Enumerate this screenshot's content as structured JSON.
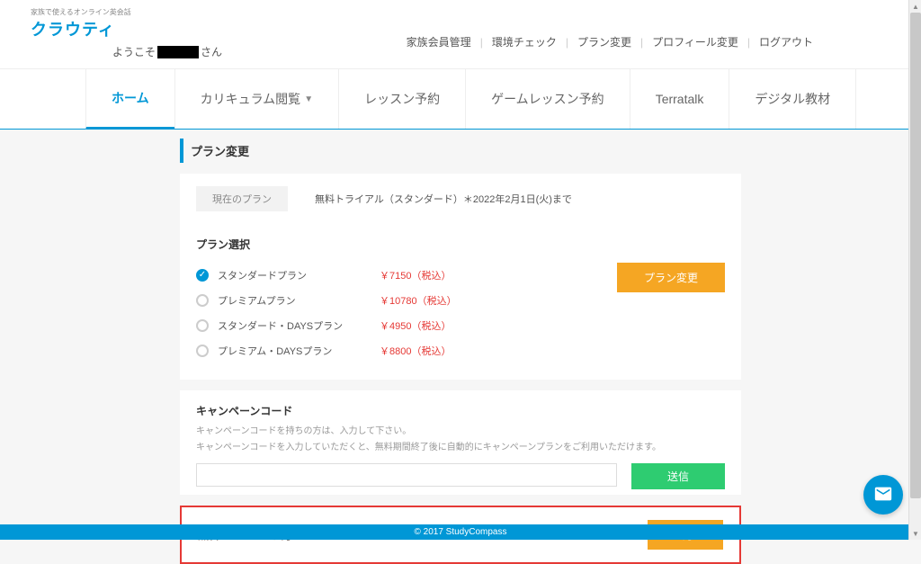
{
  "logo": {
    "tagline": "家族で使えるオンライン英会話",
    "brand": "クラウティ"
  },
  "greeting": {
    "prefix": "ようこそ",
    "suffix": "さん"
  },
  "toplinks": [
    "家族会員管理",
    "環境チェック",
    "プラン変更",
    "プロフィール変更",
    "ログアウト"
  ],
  "tabs": [
    {
      "label": "ホーム",
      "active": true
    },
    {
      "label": "カリキュラム閲覧",
      "dropdown": true
    },
    {
      "label": "レッスン予約"
    },
    {
      "label": "ゲームレッスン予約"
    },
    {
      "label": "Terratalk"
    },
    {
      "label": "デジタル教材"
    }
  ],
  "page_title": "プラン変更",
  "current_plan": {
    "badge": "現在のプラン",
    "text": "無料トライアル（スタンダード）＊2022年2月1日(火)まで"
  },
  "plan_select_heading": "プラン選択",
  "plans": [
    {
      "name": "スタンダードプラン",
      "price": "￥7150（税込）",
      "selected": true
    },
    {
      "name": "プレミアムプラン",
      "price": "￥10780（税込）",
      "selected": false
    },
    {
      "name": "スタンダード・DAYSプラン",
      "price": "￥4950（税込）",
      "selected": false
    },
    {
      "name": "プレミアム・DAYSプラン",
      "price": "￥8800（税込）",
      "selected": false
    }
  ],
  "change_plan_btn": "プラン変更",
  "campaign": {
    "heading": "キャンペーンコード",
    "note1": "キャンペーンコードを持ちの方は、入力して下さい。",
    "note2": "キャンペーンコードを入力していただくと、無料期間終了後に自動的にキャンペーンプランをご利用いただけます。",
    "submit": "送信"
  },
  "trial_end": {
    "heading": "無料トライアル終了",
    "btn": "終了"
  },
  "footer": "© 2017 StudyCompass"
}
